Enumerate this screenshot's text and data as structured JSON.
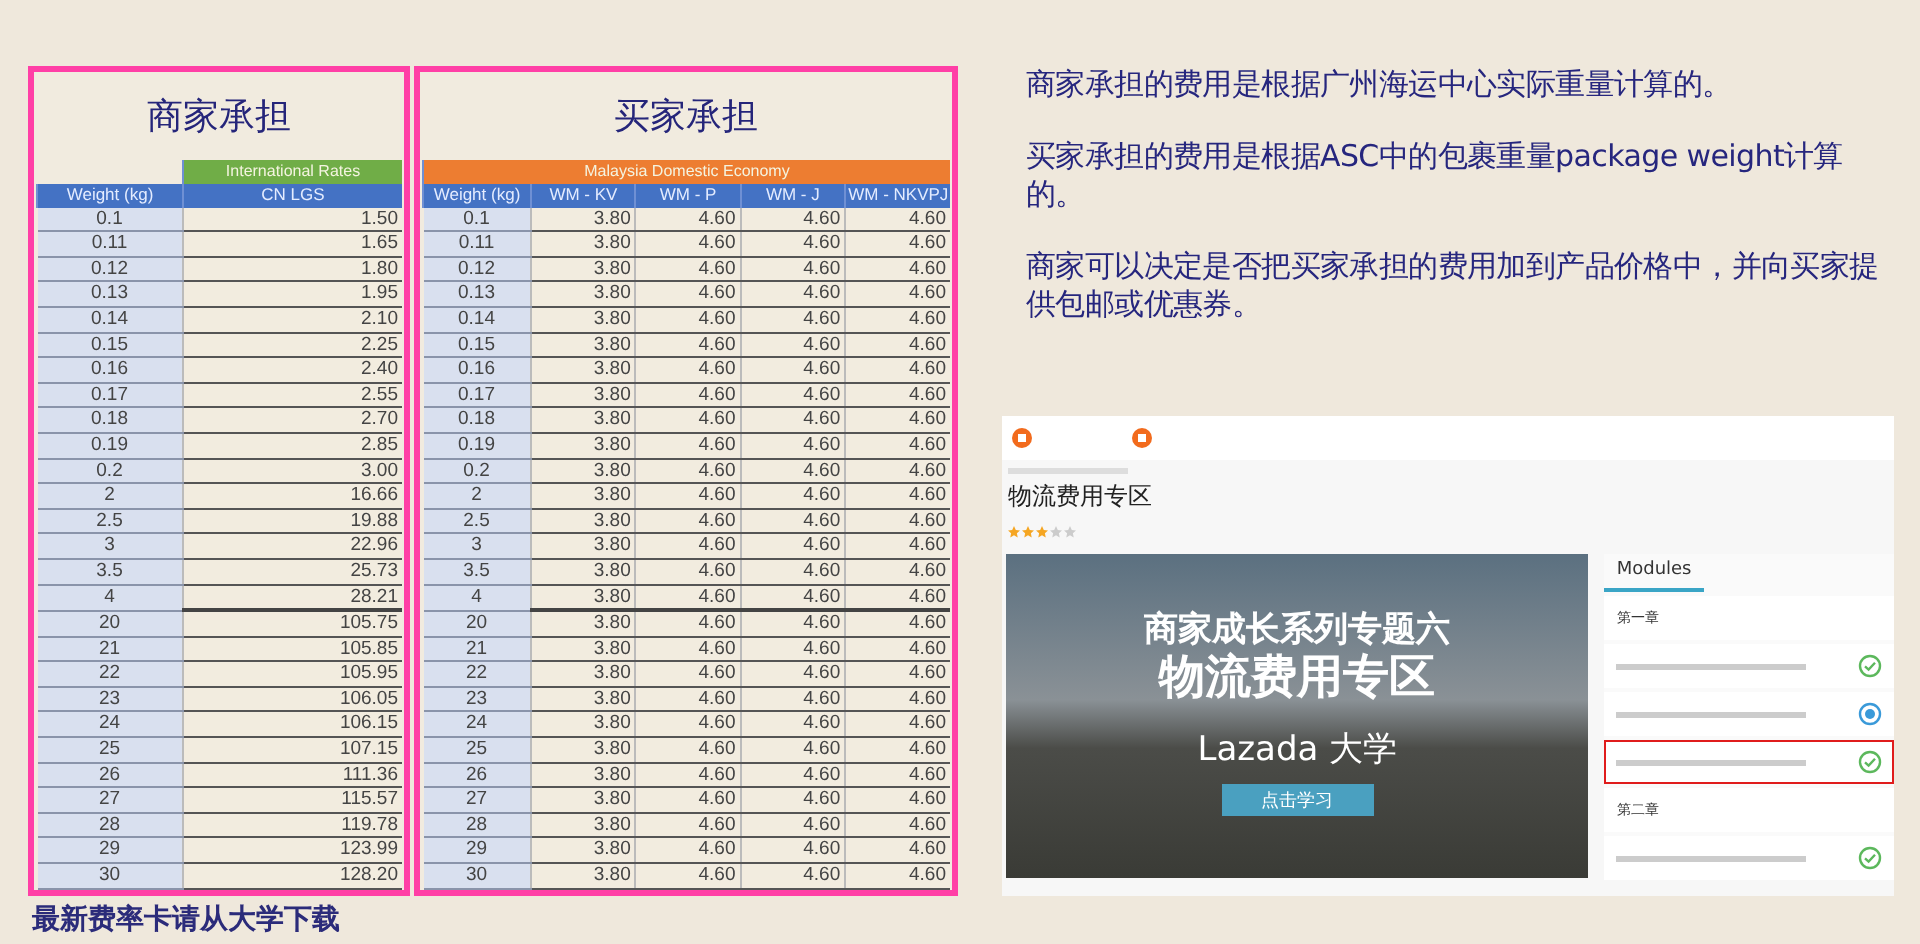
{
  "seller_table": {
    "title": "商家承担",
    "group_header": "International Rates",
    "columns": [
      "Weight (kg)",
      "CN LGS"
    ],
    "rows": [
      [
        "0.1",
        "1.50"
      ],
      [
        "0.11",
        "1.65"
      ],
      [
        "0.12",
        "1.80"
      ],
      [
        "0.13",
        "1.95"
      ],
      [
        "0.14",
        "2.10"
      ],
      [
        "0.15",
        "2.25"
      ],
      [
        "0.16",
        "2.40"
      ],
      [
        "0.17",
        "2.55"
      ],
      [
        "0.18",
        "2.70"
      ],
      [
        "0.19",
        "2.85"
      ],
      [
        "0.2",
        "3.00"
      ],
      [
        "2",
        "16.66"
      ],
      [
        "2.5",
        "19.88"
      ],
      [
        "3",
        "22.96"
      ],
      [
        "3.5",
        "25.73"
      ],
      [
        "4",
        "28.21"
      ],
      [
        "20",
        "105.75"
      ],
      [
        "21",
        "105.85"
      ],
      [
        "22",
        "105.95"
      ],
      [
        "23",
        "106.05"
      ],
      [
        "24",
        "106.15"
      ],
      [
        "25",
        "107.15"
      ],
      [
        "26",
        "111.36"
      ],
      [
        "27",
        "115.57"
      ],
      [
        "28",
        "119.78"
      ],
      [
        "29",
        "123.99"
      ],
      [
        "30",
        "128.20"
      ]
    ]
  },
  "buyer_table": {
    "title": "买家承担",
    "group_header": "Malaysia Domestic Economy",
    "columns": [
      "Weight (kg)",
      "WM - KV",
      "WM - P",
      "WM - J",
      "WM - NKVPJ"
    ],
    "rows": [
      [
        "0.1",
        "3.80",
        "4.60",
        "4.60",
        "4.60"
      ],
      [
        "0.11",
        "3.80",
        "4.60",
        "4.60",
        "4.60"
      ],
      [
        "0.12",
        "3.80",
        "4.60",
        "4.60",
        "4.60"
      ],
      [
        "0.13",
        "3.80",
        "4.60",
        "4.60",
        "4.60"
      ],
      [
        "0.14",
        "3.80",
        "4.60",
        "4.60",
        "4.60"
      ],
      [
        "0.15",
        "3.80",
        "4.60",
        "4.60",
        "4.60"
      ],
      [
        "0.16",
        "3.80",
        "4.60",
        "4.60",
        "4.60"
      ],
      [
        "0.17",
        "3.80",
        "4.60",
        "4.60",
        "4.60"
      ],
      [
        "0.18",
        "3.80",
        "4.60",
        "4.60",
        "4.60"
      ],
      [
        "0.19",
        "3.80",
        "4.60",
        "4.60",
        "4.60"
      ],
      [
        "0.2",
        "3.80",
        "4.60",
        "4.60",
        "4.60"
      ],
      [
        "2",
        "3.80",
        "4.60",
        "4.60",
        "4.60"
      ],
      [
        "2.5",
        "3.80",
        "4.60",
        "4.60",
        "4.60"
      ],
      [
        "3",
        "3.80",
        "4.60",
        "4.60",
        "4.60"
      ],
      [
        "3.5",
        "3.80",
        "4.60",
        "4.60",
        "4.60"
      ],
      [
        "4",
        "3.80",
        "4.60",
        "4.60",
        "4.60"
      ],
      [
        "20",
        "3.80",
        "4.60",
        "4.60",
        "4.60"
      ],
      [
        "21",
        "3.80",
        "4.60",
        "4.60",
        "4.60"
      ],
      [
        "22",
        "3.80",
        "4.60",
        "4.60",
        "4.60"
      ],
      [
        "23",
        "3.80",
        "4.60",
        "4.60",
        "4.60"
      ],
      [
        "24",
        "3.80",
        "4.60",
        "4.60",
        "4.60"
      ],
      [
        "25",
        "3.80",
        "4.60",
        "4.60",
        "4.60"
      ],
      [
        "26",
        "3.80",
        "4.60",
        "4.60",
        "4.60"
      ],
      [
        "27",
        "3.80",
        "4.60",
        "4.60",
        "4.60"
      ],
      [
        "28",
        "3.80",
        "4.60",
        "4.60",
        "4.60"
      ],
      [
        "29",
        "3.80",
        "4.60",
        "4.60",
        "4.60"
      ],
      [
        "30",
        "3.80",
        "4.60",
        "4.60",
        "4.60"
      ]
    ]
  },
  "caption": "最新费率卡请从大学下载",
  "notes": [
    "商家承担的费用是根据广州海运中心实际重量计算的。",
    "买家承担的费用是根据ASC中的包裹重量package weight计算的。",
    "商家可以决定是否把买家承担的费用加到产品价格中，并向买家提供包邮或优惠券。"
  ],
  "course_screenshot": {
    "title": "物流费用专区",
    "stars": 3,
    "banner": {
      "subtitle": "商家成长系列专题六",
      "headline": "物流费用专区",
      "brand": "Lazada 大学",
      "button": "点击学习"
    },
    "modules": {
      "heading": "Modules",
      "items": [
        {
          "kind": "chapter",
          "label": "第一章"
        },
        {
          "kind": "lesson",
          "completed": true,
          "highlighted": false
        },
        {
          "kind": "lesson",
          "completed": false,
          "highlighted": false
        },
        {
          "kind": "lesson",
          "completed": true,
          "highlighted": true
        },
        {
          "kind": "chapter",
          "label": "第二章"
        },
        {
          "kind": "lesson",
          "completed": true,
          "highlighted": false
        }
      ]
    }
  }
}
